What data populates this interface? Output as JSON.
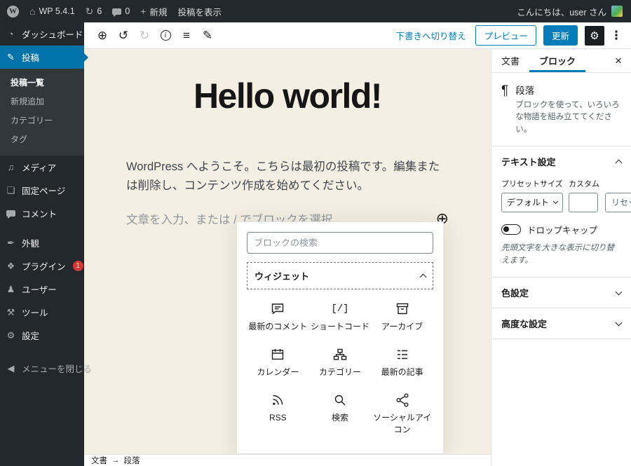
{
  "admin_bar": {
    "logo_letter": "W",
    "home_glyph": "⌂",
    "site_name": "WP 5.4.1",
    "updates_glyph": "↻",
    "updates_count": "6",
    "comments_count": "0",
    "new_glyph": "+",
    "new_label": "新規",
    "view_post_label": "投稿を表示",
    "greeting": "こんにちは、user さん"
  },
  "admin_menu": {
    "items": [
      {
        "label": "ダッシュボード",
        "glyph": "◔"
      },
      {
        "label": "投稿",
        "glyph": "✎"
      },
      {
        "label": "メディア",
        "glyph": "♫"
      },
      {
        "label": "固定ページ",
        "glyph": "❏"
      },
      {
        "label": "コメント",
        "glyph": ""
      },
      {
        "label": "外観",
        "glyph": "✒"
      },
      {
        "label": "プラグイン",
        "glyph": "❖",
        "badge": "1"
      },
      {
        "label": "ユーザー",
        "glyph": "♟"
      },
      {
        "label": "ツール",
        "glyph": "⚒"
      },
      {
        "label": "設定",
        "glyph": "⚙"
      },
      {
        "label": "メニューを閉じる",
        "glyph": "◀"
      }
    ],
    "posts_submenu": [
      {
        "label": "投稿一覧"
      },
      {
        "label": "新規追加"
      },
      {
        "label": "カテゴリー"
      },
      {
        "label": "タグ"
      }
    ]
  },
  "editor_header": {
    "inserter_glyph": "⊕",
    "undo_glyph": "↺",
    "redo_glyph": "↻",
    "info_glyph": "i",
    "list_glyph": "≡",
    "pencil_glyph": "✎",
    "switch_to_draft_label": "下書きへ切り替え",
    "preview_label": "プレビュー",
    "update_label": "更新",
    "gear_glyph": "⚙",
    "more_glyph": "⋮"
  },
  "canvas": {
    "post_title": "Hello world!",
    "paragraph": "WordPress へようこそ。こちらは最初の投稿です。編集または削除し、コンテンツ作成を始めてください。",
    "placeholder": "文章を入力、または / でブロックを選択",
    "side_inserter_glyph": "⊕"
  },
  "inserter": {
    "search_placeholder": "ブロックの検索",
    "section_title": "ウィジェット",
    "blocks": [
      {
        "label": "最新のコメント",
        "icon": "comment-icon"
      },
      {
        "label": "ショートコード",
        "icon": "shortcode-icon",
        "glyph": "[/]"
      },
      {
        "label": "アーカイブ",
        "icon": "archive-icon"
      },
      {
        "label": "カレンダー",
        "icon": "calendar-icon"
      },
      {
        "label": "カテゴリー",
        "icon": "category-icon"
      },
      {
        "label": "最新の記事",
        "icon": "latest-posts-icon"
      },
      {
        "label": "RSS",
        "icon": "rss-icon"
      },
      {
        "label": "検索",
        "icon": "search-icon"
      },
      {
        "label": "ソーシャルアイコン",
        "icon": "share-icon"
      }
    ]
  },
  "sidebar": {
    "tab_document": "文書",
    "tab_block": "ブロック",
    "close_glyph": "×",
    "block_card": {
      "icon_glyph": "¶",
      "title": "段落",
      "description": "ブロックを使って、いろいろな物語を組み立ててください。"
    },
    "text_settings": {
      "title": "テキスト設定",
      "preset_label": "プリセットサイズ",
      "custom_label": "カスタム",
      "preset_value": "デフォルト",
      "reset_label": "リセット",
      "dropcap_label": "ドロップキャップ",
      "dropcap_help": "先頭文字を大きな表示に切り替えます。"
    },
    "color_panel_title": "色設定",
    "advanced_panel_title": "高度な設定"
  },
  "footer": {
    "breadcrumb_root": "文書",
    "breadcrumb_arrow": "→",
    "breadcrumb_current": "段落"
  },
  "colors": {
    "accent": "#007cba",
    "menu_active": "#0073aa",
    "admin_dark": "#23282d",
    "canvas_bg": "#f3efe2",
    "badge_red": "#d63638"
  }
}
